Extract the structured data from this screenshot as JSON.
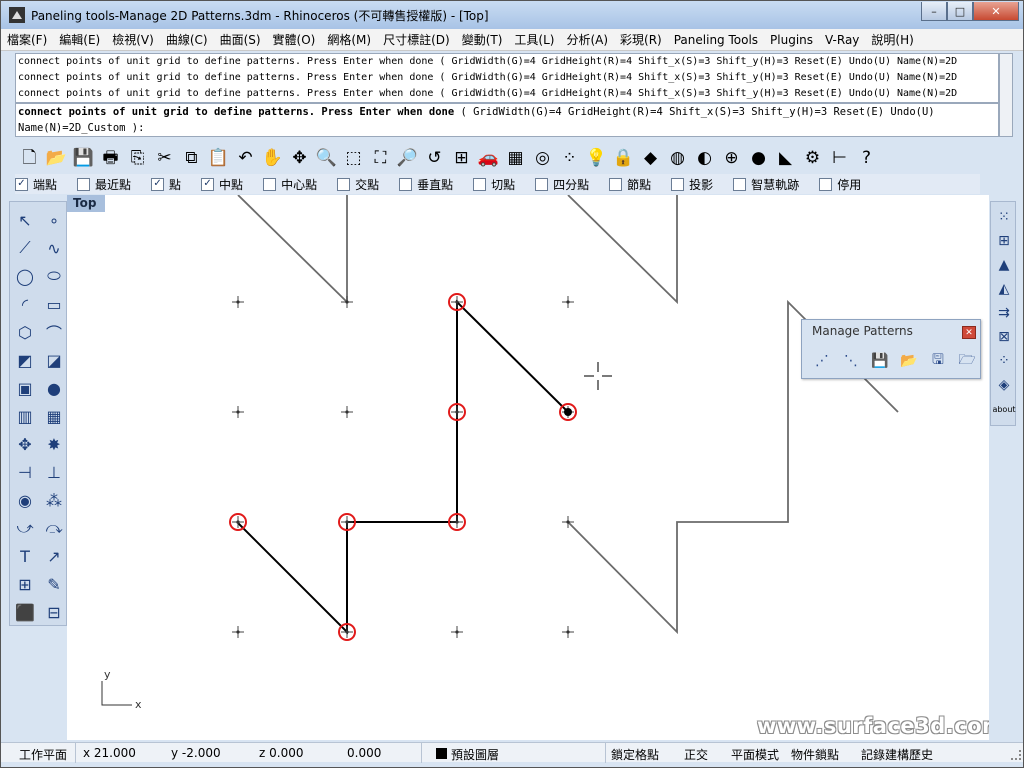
{
  "window": {
    "title": "Paneling tools-Manage 2D Patterns.3dm - Rhinoceros (不可轉售授權版) - [Top]",
    "minimize_glyph": "–",
    "maximize_glyph": "□",
    "close_glyph": "✕"
  },
  "menu": [
    "檔案(F)",
    "編輯(E)",
    "檢視(V)",
    "曲線(C)",
    "曲面(S)",
    "實體(O)",
    "網格(M)",
    "尺寸標註(D)",
    "變動(T)",
    "工具(L)",
    "分析(A)",
    "彩現(R)",
    "Paneling Tools",
    "Plugins",
    "V-Ray",
    "說明(H)"
  ],
  "command_history": [
    "connect points of unit grid to define patterns.  Press Enter when done ( GridWidth(G)=4  GridHeight(R)=4  Shift_x(S)=3  Shift_y(H)=3  Reset(E)  Undo(U)  Name(N)=2D",
    "connect points of unit grid to define patterns.  Press Enter when done ( GridWidth(G)=4  GridHeight(R)=4  Shift_x(S)=3  Shift_y(H)=3  Reset(E)  Undo(U)  Name(N)=2D",
    "connect points of unit grid to define patterns.  Press Enter when done ( GridWidth(G)=4  GridHeight(R)=4  Shift_x(S)=3  Shift_y(H)=3  Reset(E)  Undo(U)  Name(N)=2D"
  ],
  "command_prompt": {
    "bold": "connect points of unit grid to define patterns.  Press Enter when done",
    "options": " ( GridWidth(G)=4  GridHeight(R)=4  Shift_x(S)=3  Shift_y(H)=3  Reset(E)  Undo(U)",
    "line2": "Name(N)=2D_Custom ):"
  },
  "toolbar": [
    {
      "icon": "new-file-icon",
      "glyph": "🗋"
    },
    {
      "icon": "open-folder-icon",
      "glyph": "📂"
    },
    {
      "icon": "save-icon",
      "glyph": "💾"
    },
    {
      "icon": "print-icon",
      "glyph": "🖶"
    },
    {
      "icon": "import-icon",
      "glyph": "⎘"
    },
    {
      "icon": "cut-icon",
      "glyph": "✂"
    },
    {
      "icon": "copy-icon",
      "glyph": "⧉"
    },
    {
      "icon": "paste-icon",
      "glyph": "📋"
    },
    {
      "icon": "undo-icon",
      "glyph": "↶"
    },
    {
      "icon": "pan-hand-icon",
      "glyph": "✋"
    },
    {
      "icon": "rotate-view-icon",
      "glyph": "✥"
    },
    {
      "icon": "zoom-dynamic-icon",
      "glyph": "🔍"
    },
    {
      "icon": "zoom-window-icon",
      "glyph": "⬚"
    },
    {
      "icon": "zoom-extents-icon",
      "glyph": "⛶"
    },
    {
      "icon": "zoom-selected-icon",
      "glyph": "🔎"
    },
    {
      "icon": "undo-view-icon",
      "glyph": "↺"
    },
    {
      "icon": "four-viewports-icon",
      "glyph": "⊞"
    },
    {
      "icon": "car-icon",
      "glyph": "🚗"
    },
    {
      "icon": "grid-plane-icon",
      "glyph": "▦"
    },
    {
      "icon": "osnap-target-icon",
      "glyph": "◎"
    },
    {
      "icon": "select-points-icon",
      "glyph": "⁘"
    },
    {
      "icon": "light-bulb-icon",
      "glyph": "💡"
    },
    {
      "icon": "lock-icon",
      "glyph": "🔒"
    },
    {
      "icon": "material-icon",
      "glyph": "◆"
    },
    {
      "icon": "color-wheel-icon",
      "glyph": "◍"
    },
    {
      "icon": "shaded-sphere-icon",
      "glyph": "◐"
    },
    {
      "icon": "wire-sphere-icon",
      "glyph": "⊕"
    },
    {
      "icon": "render-sphere-icon",
      "glyph": "●"
    },
    {
      "icon": "light-cone-icon",
      "glyph": "◣"
    },
    {
      "icon": "settings-gear-icon",
      "glyph": "⚙"
    },
    {
      "icon": "dimension-icon",
      "glyph": "⊢"
    },
    {
      "icon": "help-icon",
      "glyph": "?"
    }
  ],
  "osnaps": [
    {
      "label": "端點",
      "checked": true
    },
    {
      "label": "最近點",
      "checked": false
    },
    {
      "label": "點",
      "checked": true
    },
    {
      "label": "中點",
      "checked": true
    },
    {
      "label": "中心點",
      "checked": false
    },
    {
      "label": "交點",
      "checked": false
    },
    {
      "label": "垂直點",
      "checked": false
    },
    {
      "label": "切點",
      "checked": false
    },
    {
      "label": "四分點",
      "checked": false
    },
    {
      "label": "節點",
      "checked": false
    },
    {
      "label": "投影",
      "checked": false
    },
    {
      "label": "智慧軌跡",
      "checked": false
    },
    {
      "label": "停用",
      "checked": false
    }
  ],
  "left_tools": [
    [
      "select-arrow-icon",
      "↖"
    ],
    [
      "point-icon",
      "∘"
    ],
    [
      "polyline-icon",
      "⟋"
    ],
    [
      "curve-icon",
      "∿"
    ],
    [
      "circle-icon",
      "◯"
    ],
    [
      "ellipse-icon",
      "⬭"
    ],
    [
      "arc-icon",
      "◜"
    ],
    [
      "rectangle-icon",
      "▭"
    ],
    [
      "polygon-icon",
      "⬡"
    ],
    [
      "fillet-icon",
      "⌒"
    ],
    [
      "surface-corner-icon",
      "◩"
    ],
    [
      "surface-edge-icon",
      "◪"
    ],
    [
      "box-icon",
      "▣"
    ],
    [
      "sphere-icon",
      "●"
    ],
    [
      "cylinder-icon",
      "▥"
    ],
    [
      "mesh-icon",
      "▦"
    ],
    [
      "transform-icon",
      "✥"
    ],
    [
      "explode-icon",
      "✸"
    ],
    [
      "trim-icon",
      "⊣"
    ],
    [
      "split-icon",
      "⊥"
    ],
    [
      "boolean-icon",
      "◉"
    ],
    [
      "group-icon",
      "⁂"
    ],
    [
      "curve-tools-icon",
      "⤻"
    ],
    [
      "blend-icon",
      "⤼"
    ],
    [
      "text-icon",
      "T"
    ],
    [
      "dimension-tool-icon",
      "↗"
    ],
    [
      "array-icon",
      "⊞"
    ],
    [
      "analyze-icon",
      "✎"
    ],
    [
      "render-cube-icon",
      "⬛"
    ],
    [
      "layout-icon",
      "⊟"
    ]
  ],
  "right_tools": [
    [
      "paneling-grid-icon",
      "⁙"
    ],
    [
      "paneling-array-icon",
      "⊞"
    ],
    [
      "paneling-triangle-icon",
      "▲"
    ],
    [
      "paneling-surface-icon",
      "◭"
    ],
    [
      "paneling-shift-icon",
      "⇉"
    ],
    [
      "paneling-box-icon",
      "⊠"
    ],
    [
      "paneling-points-icon",
      "⁘"
    ],
    [
      "paneling-diamond-icon",
      "◈"
    ],
    [
      "about-icon",
      "about"
    ]
  ],
  "viewport": {
    "tab": "Top",
    "axis_x": "x",
    "axis_y": "y"
  },
  "watermark": "www.surface3d.com.tw",
  "manage_patterns": {
    "title": "Manage Patterns",
    "close_glyph": "✕",
    "buttons": [
      [
        "pattern-lines-icon",
        "⋰"
      ],
      [
        "pattern-grid-icon",
        "⋱"
      ],
      [
        "pattern-save-icon",
        "💾"
      ],
      [
        "pattern-open-icon",
        "📂"
      ],
      [
        "pattern-save-3d-icon",
        "🖫"
      ],
      [
        "pattern-open-3d-icon",
        "🗁"
      ]
    ]
  },
  "status": {
    "cplane": "工作平面",
    "x": "x 21.000",
    "y": "y -2.000",
    "z": "z 0.000",
    "dist": "0.000",
    "layer": "預設圖層",
    "snap": "鎖定格點",
    "ortho": "正交",
    "planar": "平面模式",
    "osnap": "物件鎖點",
    "history": "記錄建構歷史"
  },
  "colors": {
    "selected_point_ring": "#e11a1a",
    "pattern_line": "#000000",
    "shifted_pattern_line": "#6b6b6b",
    "grid_point": "#444444"
  }
}
